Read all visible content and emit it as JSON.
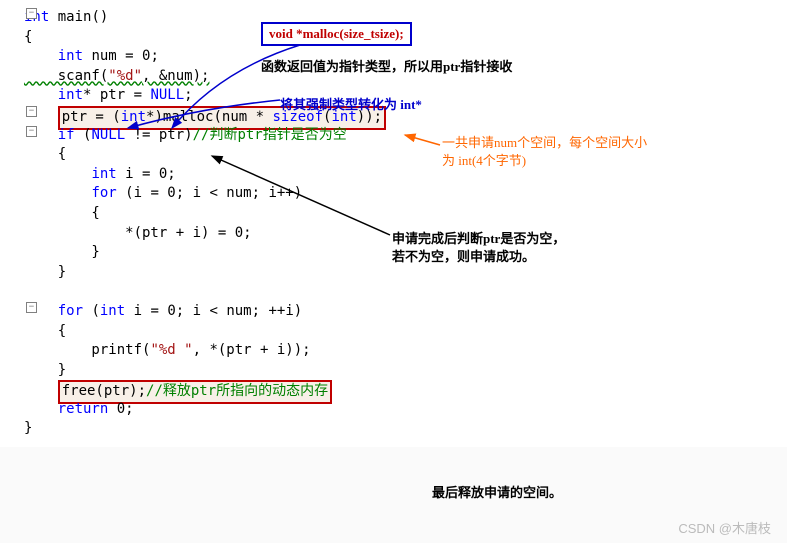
{
  "callout": {
    "text": "void *malloc(size_tsize);"
  },
  "ann": {
    "retval": "函数返回值为指针类型，所以用ptr指针接收",
    "cast": "将其强制类型转化为 int*",
    "alloc1": "一共申请num个空间，每个空间大小",
    "alloc2": "为 int(4个字节)",
    "check1": "申请完成后判断ptr是否为空，",
    "check2": "若不为空，则申请成功。",
    "free": "最后释放申请的空间。"
  },
  "watermark": "CSDN @木唐枝",
  "code": {
    "l1_kw": "int",
    "l1_id": " main()",
    "l2": "{",
    "l3_a": "    ",
    "l3_kw": "int",
    "l3_b": " num = 0;",
    "l4_a": "    scanf(",
    "l4_str": "\"%d\"",
    "l4_b": ", &num);",
    "l5_a": "    ",
    "l5_kw": "int",
    "l5_b": "* ptr = ",
    "l5_null": "NULL",
    "l5_c": ";",
    "l6_a": "ptr = (",
    "l6_kw": "int",
    "l6_b": "*)malloc(num * ",
    "l6_kw2": "sizeof",
    "l6_c": "(",
    "l6_kw3": "int",
    "l6_d": "));",
    "l7_a": "    ",
    "l7_kw": "if",
    "l7_b": " (",
    "l7_null": "NULL",
    "l7_c": " != ptr)",
    "l7_cm": "//判断ptr指针是否为空",
    "l8": "    {",
    "l9_a": "        ",
    "l9_kw": "int",
    "l9_b": " i = 0;",
    "l10_a": "        ",
    "l10_kw": "for",
    "l10_b": " (i = 0; i < num; i++)",
    "l11": "        {",
    "l12": "            *(ptr + i) = 0;",
    "l13": "        }",
    "l14": "    }",
    "l15": "",
    "l16_a": "    ",
    "l16_kw": "for",
    "l16_b": " (",
    "l16_kw2": "int",
    "l16_c": " i = 0; i < num; ++i)",
    "l17": "    {",
    "l18_a": "        printf(",
    "l18_str": "\"%d \"",
    "l18_b": ", *(ptr + i));",
    "l19": "    }",
    "l20_a": "free(ptr);",
    "l20_cm": "//释放ptr所指向的动态内存",
    "l21_a": "    ",
    "l21_kw": "return",
    "l21_b": " 0;",
    "l22": "}"
  }
}
